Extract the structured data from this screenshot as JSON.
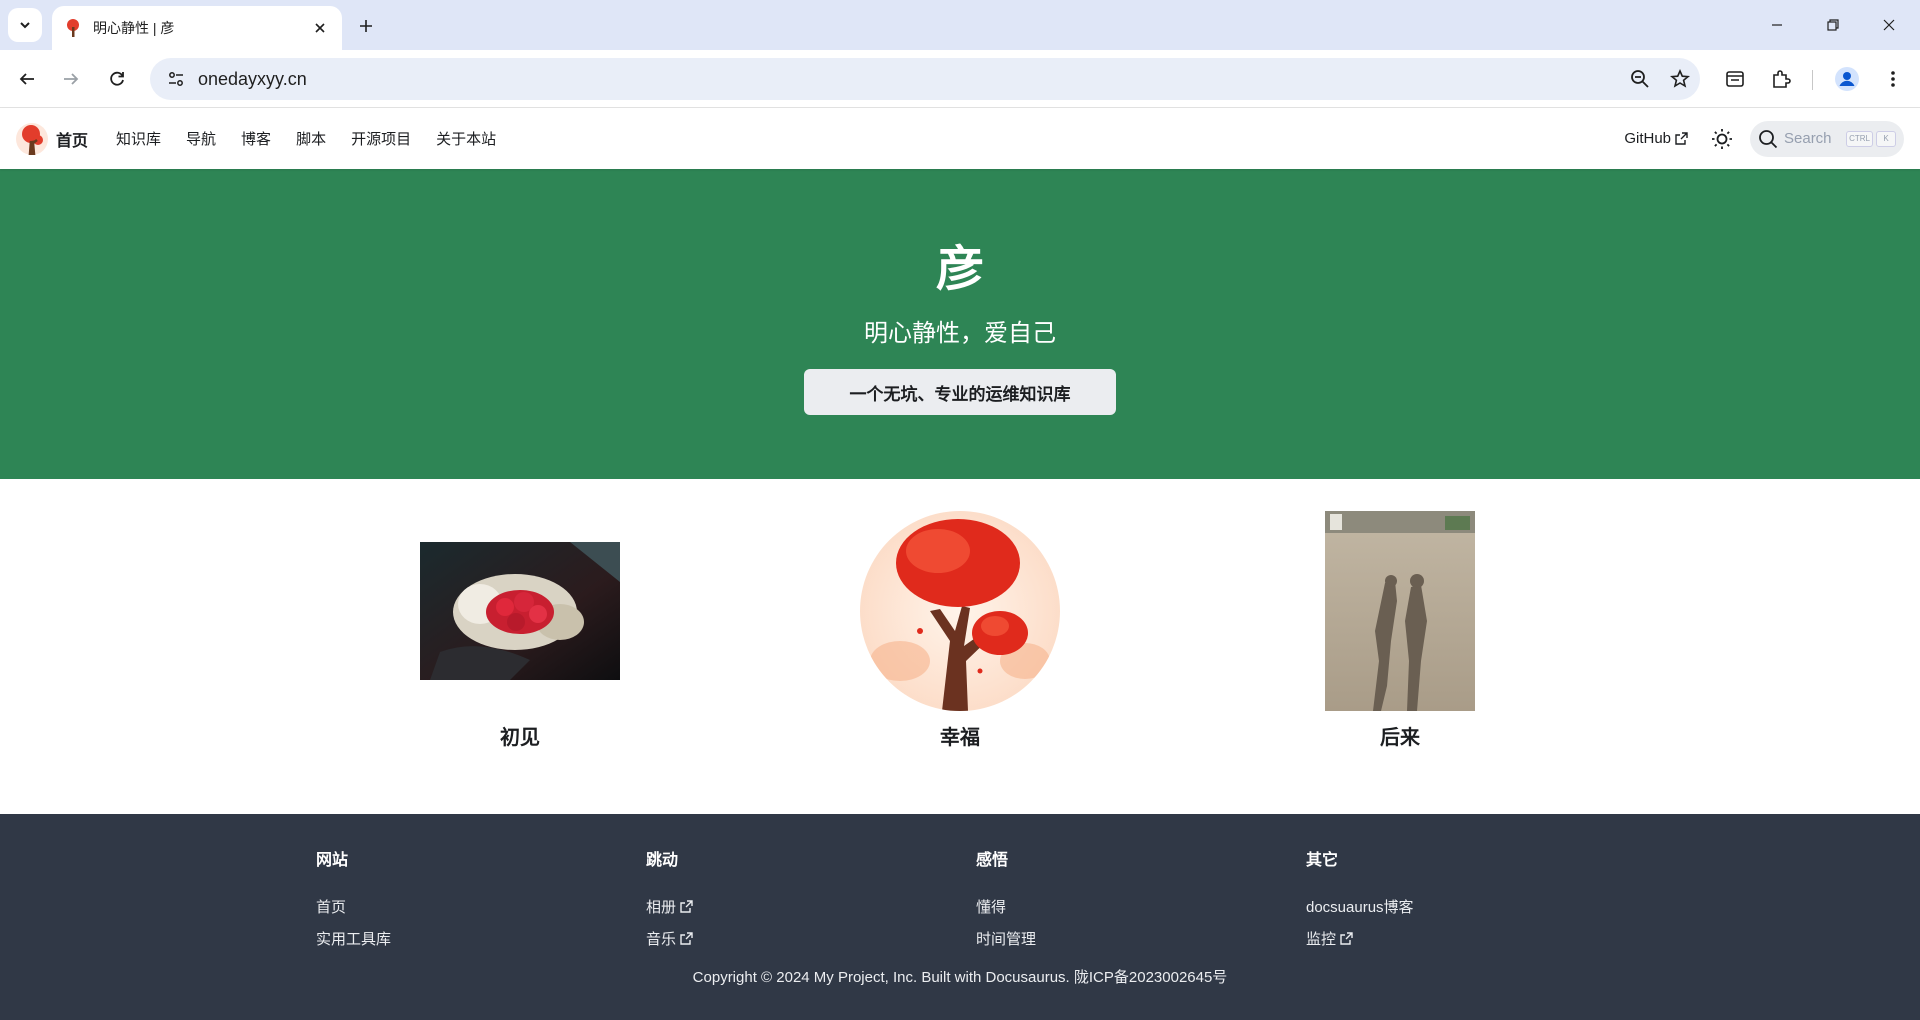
{
  "browser": {
    "tab_title": "明心静性 | 彦",
    "url": "onedayxyy.cn"
  },
  "navbar": {
    "brand": "首页",
    "items": [
      "知识库",
      "导航",
      "博客",
      "脚本",
      "开源项目",
      "关于本站"
    ],
    "github_label": "GitHub",
    "search_label": "Search",
    "search_keys": [
      "CTRL",
      "K"
    ]
  },
  "hero": {
    "title": "彦",
    "subtitle": "明心静性，爱自己",
    "button_label": "一个无坑、专业的运维知识库"
  },
  "features": [
    {
      "title": "初见",
      "image": "rose-bouquet-photo"
    },
    {
      "title": "幸福",
      "image": "red-tree-illustration"
    },
    {
      "title": "后来",
      "image": "couple-shadow-photo"
    }
  ],
  "footer": {
    "columns": [
      {
        "title": "网站",
        "links": [
          "首页",
          "实用工具库"
        ]
      },
      {
        "title": "跳动",
        "links": [
          "相册",
          "音乐"
        ]
      },
      {
        "title": "感悟",
        "links": [
          "懂得",
          "时间管理"
        ]
      },
      {
        "title": "其它",
        "links": [
          "docsuaurus博客",
          "监控"
        ]
      }
    ],
    "copyright": "Copyright © 2024 My Project, Inc. Built with Docusaurus. 陇ICP备2023002645号"
  },
  "colors": {
    "hero_bg": "#2e8555",
    "footer_bg": "#303846",
    "tabbar_bg": "#dfe6f7"
  }
}
